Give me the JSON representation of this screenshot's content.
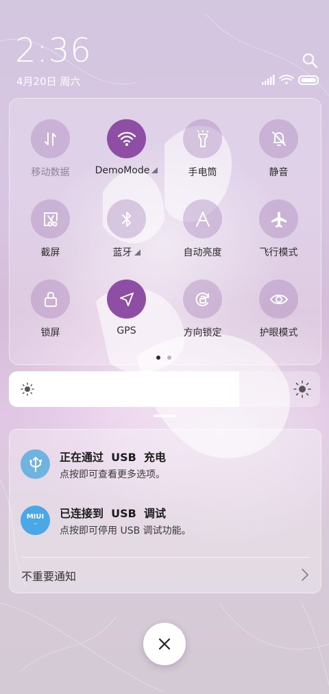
{
  "status": {
    "time": "2:36",
    "date": "4月20日 周六",
    "icons": [
      "signal-icon",
      "wifi-icon",
      "battery-icon"
    ]
  },
  "search": {
    "icon": "search-icon"
  },
  "quick_settings": {
    "tiles": [
      {
        "label": "移动数据",
        "icon": "mobile-data-icon",
        "active": false,
        "dimmed": true
      },
      {
        "label": "DemoMode",
        "icon": "wifi-icon",
        "active": true,
        "dimmed": false,
        "expandable": true
      },
      {
        "label": "手电筒",
        "icon": "flashlight-icon",
        "active": false,
        "dimmed": false
      },
      {
        "label": "静音",
        "icon": "mute-bell-icon",
        "active": false,
        "dimmed": false
      },
      {
        "label": "截屏",
        "icon": "screenshot-icon",
        "active": false,
        "dimmed": false
      },
      {
        "label": "蓝牙",
        "icon": "bluetooth-icon",
        "active": false,
        "dimmed": false,
        "expandable": true
      },
      {
        "label": "自动亮度",
        "icon": "auto-brightness-icon",
        "active": false,
        "dimmed": false
      },
      {
        "label": "飞行模式",
        "icon": "airplane-icon",
        "active": false,
        "dimmed": false
      },
      {
        "label": "锁屏",
        "icon": "lock-icon",
        "active": false,
        "dimmed": false
      },
      {
        "label": "GPS",
        "icon": "gps-arrow-icon",
        "active": true,
        "dimmed": false
      },
      {
        "label": "方向锁定",
        "icon": "rotation-lock-icon",
        "active": false,
        "dimmed": false
      },
      {
        "label": "护眼模式",
        "icon": "eye-icon",
        "active": false,
        "dimmed": false
      }
    ],
    "pages": 2,
    "current_page": 1
  },
  "brightness": {
    "level_percent": 74,
    "low_icon": "sun-small-icon",
    "high_icon": "sun-large-icon"
  },
  "notifications": {
    "items": [
      {
        "title": "正在通过  USB  充电",
        "body": "点按即可查看更多选项。",
        "icon": "usb-icon"
      },
      {
        "title": "已连接到  USB  调试",
        "body": "点按即可停用 USB 调试功能。",
        "icon": "miui-icon",
        "icon_text": "MIUI"
      }
    ],
    "minor_label": "不重要通知"
  },
  "close": {
    "icon": "close-icon"
  },
  "colors": {
    "accent": "#8d4ea4",
    "tile_idle": "#b69cc6",
    "usb_icon_bg": "#6fb4de",
    "miui_icon_bg": "#4aa8e6"
  }
}
